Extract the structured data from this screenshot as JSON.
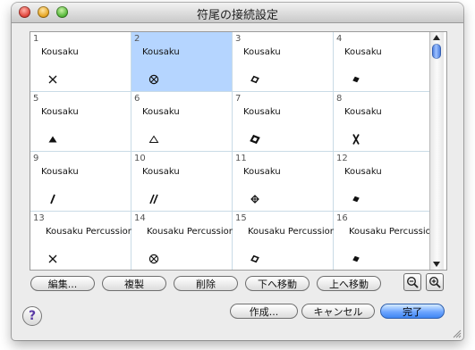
{
  "window": {
    "title": "符尾の接続設定"
  },
  "grid": {
    "selected_index": 2,
    "cells": [
      {
        "num": "1",
        "name": "Kousaku",
        "symbol": "x-icon"
      },
      {
        "num": "2",
        "name": "Kousaku",
        "symbol": "circled-x-icon"
      },
      {
        "num": "3",
        "name": "Kousaku",
        "symbol": "diamond-outline-icon"
      },
      {
        "num": "4",
        "name": "Kousaku",
        "symbol": "diamond-filled-icon"
      },
      {
        "num": "5",
        "name": "Kousaku",
        "symbol": "triangle-filled-icon"
      },
      {
        "num": "6",
        "name": "Kousaku",
        "symbol": "triangle-outline-icon"
      },
      {
        "num": "7",
        "name": "Kousaku",
        "symbol": "diamond-bold-outline-icon"
      },
      {
        "num": "8",
        "name": "Kousaku",
        "symbol": "x-bold-icon"
      },
      {
        "num": "9",
        "name": "Kousaku",
        "symbol": "slash-icon"
      },
      {
        "num": "10",
        "name": "Kousaku",
        "symbol": "double-slash-icon"
      },
      {
        "num": "11",
        "name": "Kousaku",
        "symbol": "diamond-cross-icon"
      },
      {
        "num": "12",
        "name": "Kousaku",
        "symbol": "diamond-filled-icon"
      },
      {
        "num": "13",
        "name": "Kousaku Percussion",
        "symbol": "x-icon"
      },
      {
        "num": "14",
        "name": "Kousaku Percussion",
        "symbol": "circled-x-icon"
      },
      {
        "num": "15",
        "name": "Kousaku Percussion",
        "symbol": "diamond-outline-icon"
      },
      {
        "num": "16",
        "name": "Kousaku Percussion",
        "symbol": "diamond-filled-icon"
      }
    ]
  },
  "toolbar": {
    "edit_label": "編集...",
    "duplicate_label": "複製",
    "delete_label": "削除",
    "move_down_label": "下へ移動",
    "move_up_label": "上へ移動"
  },
  "icons": {
    "zoom_out": "zoom-out-icon",
    "zoom_in": "zoom-in-icon",
    "help": "?"
  },
  "footer": {
    "create_label": "作成...",
    "cancel_label": "キャンセル",
    "done_label": "完了"
  },
  "colors": {
    "selection": "#b5d5ff",
    "default_button": "#3f86f2",
    "scroll_thumb": "#3a6fd8"
  }
}
